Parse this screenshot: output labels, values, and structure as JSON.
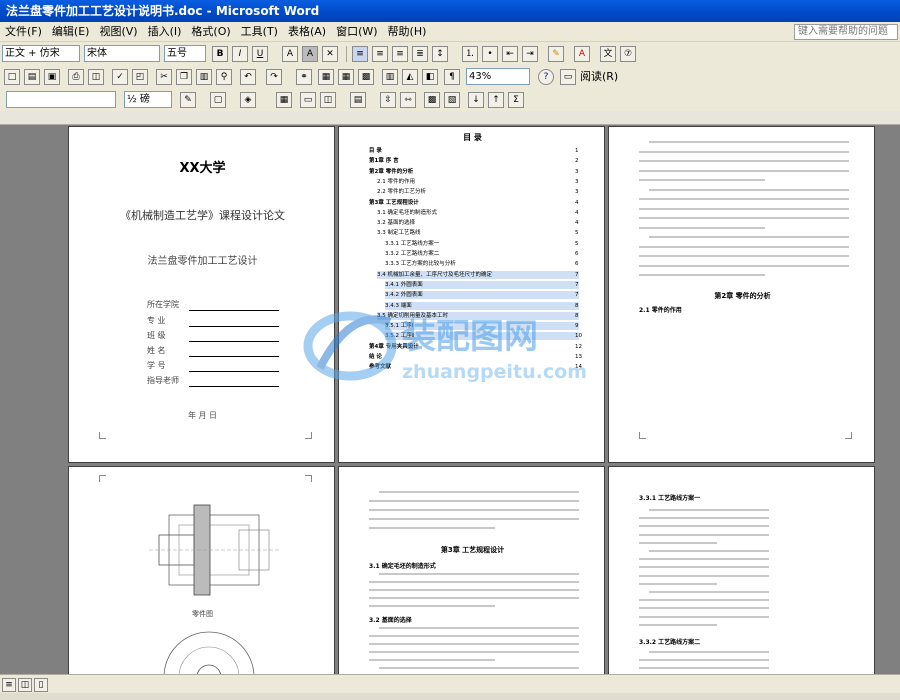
{
  "window": {
    "title": "法兰盘零件加工工艺设计说明书.doc - Microsoft Word"
  },
  "menu": {
    "items": [
      "文件(F)",
      "编辑(E)",
      "视图(V)",
      "插入(I)",
      "格式(O)",
      "工具(T)",
      "表格(A)",
      "窗口(W)",
      "帮助(H)"
    ],
    "help_placeholder": "键入需要帮助的问题"
  },
  "format_bar": {
    "style": "正文 + 仿宋",
    "font": "宋体",
    "size": "五号",
    "bold": "B",
    "italic": "I",
    "underline": "U",
    "char_border": "A",
    "char_shade": "A"
  },
  "standard_bar": {
    "zoom": "43%",
    "read_label": "阅读(R)"
  },
  "table_bar": {
    "line_weight": "½ 磅"
  },
  "pages": {
    "p1": {
      "school": "XX大学",
      "course": "《机械制造工艺学》课程设计论文",
      "topic": "法兰盘零件加工工艺设计",
      "fields": [
        "所在学院",
        "专    业",
        "班    级",
        "姓    名",
        "学    号",
        "指导老师"
      ],
      "footer": "年   月   日"
    },
    "p2": {
      "heading": "目  录",
      "toc": [
        "目    录",
        "第1章  序    言",
        "第2章  零件的分析",
        "2.1 零件的作用",
        "2.2 零件的工艺分析",
        "第3章  工艺规程设计",
        "3.1 确定毛坯的制造形式",
        "3.2 基面的选择",
        "3.3 制定工艺路线",
        "3.3.1 工艺路线方案一",
        "3.3.2 工艺路线方案二",
        "3.3.3 工艺方案的比较与分析",
        "3.4 机械加工余量、工序尺寸及毛坯尺寸的确定",
        "3.4.1 外圆表面",
        "3.4.2 外圆表面",
        "3.4.3 端面",
        "3.5 确定切削用量及基本工时",
        "3.5.1 工序Ⅰ",
        "3.5.2 工序Ⅱ",
        "第4章  专用夹具设计",
        "结    论",
        "参考文献"
      ],
      "pnum": [
        "1",
        "2",
        "3",
        "3",
        "3",
        "4",
        "4",
        "4",
        "5",
        "5",
        "6",
        "6",
        "7",
        "7",
        "7",
        "8",
        "8",
        "9",
        "10",
        "12",
        "13",
        "14"
      ]
    },
    "p3": {
      "heading": "第2章  零件的分析",
      "sub": "2.1 零件的作用"
    },
    "p4": {
      "caption": "零件图"
    },
    "p5": {
      "heading": "第3章  工艺规程设计",
      "s1": "3.1 确定毛坯的制造形式",
      "s2": "3.2 基面的选择"
    },
    "p6": {
      "heading": "3.3.1 工艺路线方案一",
      "heading2": "3.3.2 工艺路线方案二"
    }
  },
  "watermark": {
    "text1": "装配图网",
    "text2": "zhuangpeitu.com"
  }
}
